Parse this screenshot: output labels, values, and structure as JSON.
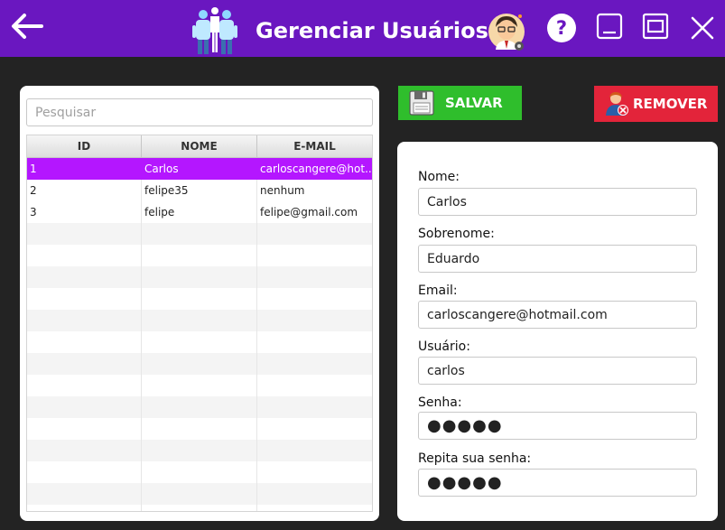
{
  "window": {
    "title": "Gerenciar Usuários"
  },
  "colors": {
    "titlebar": "#6a17c0",
    "background": "#232323",
    "selected_row": "#b416ff",
    "save": "#2fbe2c",
    "remove": "#e3243a"
  },
  "icons": {
    "back": "back-arrow-icon",
    "logo": "users-group-icon",
    "avatar": "user-avatar-icon",
    "help": "help-icon",
    "minimize": "minimize-icon",
    "maximize": "maximize-icon",
    "close": "close-icon",
    "save": "save-icon",
    "remove": "remove-user-icon"
  },
  "search": {
    "placeholder": "Pesquisar"
  },
  "table": {
    "columns": [
      "ID",
      "NOME",
      "E-MAIL"
    ],
    "rows": [
      {
        "id": "1",
        "nome": "Carlos",
        "email": "carloscangere@hot...",
        "selected": true
      },
      {
        "id": "2",
        "nome": "felipe35",
        "email": "nenhum",
        "selected": false
      },
      {
        "id": "3",
        "nome": "felipe",
        "email": "felipe@gmail.com",
        "selected": false
      }
    ]
  },
  "buttons": {
    "save_label": "SALVAR",
    "remove_label": "REMOVER"
  },
  "form": {
    "fields": [
      {
        "label": "Nome:",
        "value": "Carlos"
      },
      {
        "label": "Sobrenome:",
        "value": "Eduardo"
      },
      {
        "label": "Email:",
        "value": "carloscangere@hotmail.com"
      },
      {
        "label": "Usuário:",
        "value": "carlos"
      },
      {
        "label": "Senha:",
        "value": "●●●●●"
      },
      {
        "label": "Repita sua senha:",
        "value": "●●●●●"
      }
    ]
  }
}
